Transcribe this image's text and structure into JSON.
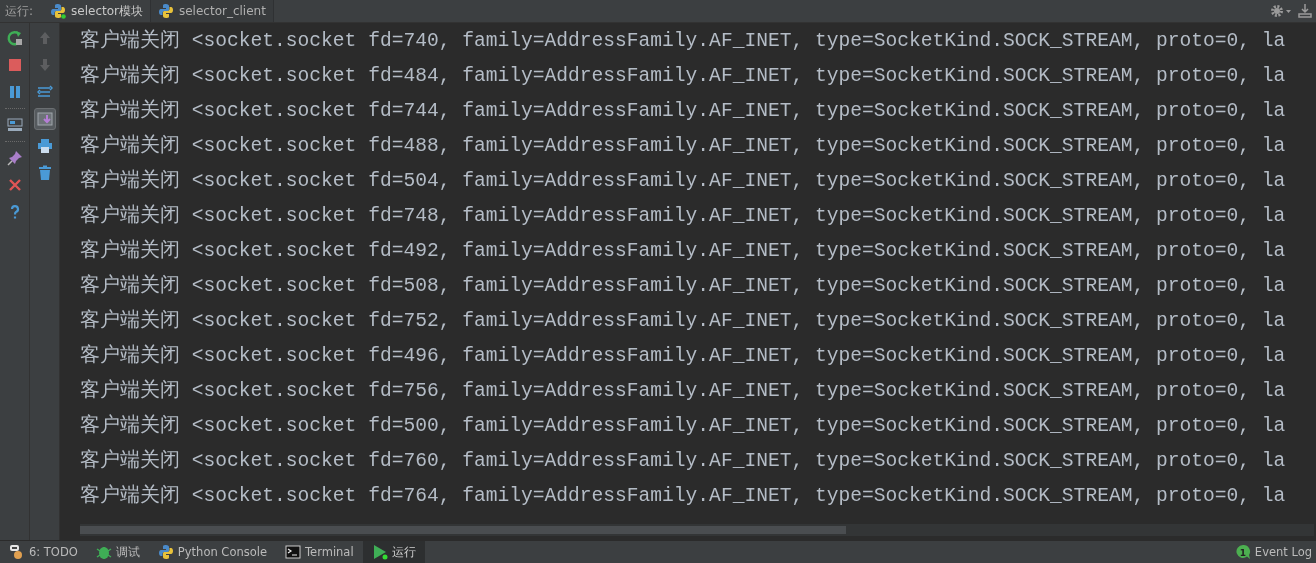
{
  "run_bar": {
    "label": "运行:",
    "tabs": [
      {
        "label": "selector模块",
        "selected": true,
        "running": true
      },
      {
        "label": "selector_client",
        "selected": false,
        "running": false
      }
    ]
  },
  "side_toolbar": [
    {
      "kind": "rerun",
      "disabled": false
    },
    {
      "kind": "stop",
      "disabled": false
    },
    {
      "kind": "pause",
      "disabled": false
    },
    {
      "kind": "layout",
      "disabled": false
    },
    {
      "kind": "pin",
      "disabled": false
    },
    {
      "kind": "close",
      "disabled": false
    },
    {
      "kind": "help",
      "disabled": false
    }
  ],
  "console_toolbar": [
    {
      "kind": "up",
      "disabled": true,
      "toggled": false
    },
    {
      "kind": "down",
      "disabled": true,
      "toggled": false
    },
    {
      "kind": "wrap",
      "disabled": false,
      "toggled": false
    },
    {
      "kind": "scroll_end",
      "disabled": false,
      "toggled": true
    },
    {
      "kind": "print",
      "disabled": false,
      "toggled": false
    },
    {
      "kind": "trash",
      "disabled": false,
      "toggled": false
    }
  ],
  "console_lines": [
    "客户端关闭 <socket.socket fd=740, family=AddressFamily.AF_INET, type=SocketKind.SOCK_STREAM, proto=0, la",
    "客户端关闭 <socket.socket fd=484, family=AddressFamily.AF_INET, type=SocketKind.SOCK_STREAM, proto=0, la",
    "客户端关闭 <socket.socket fd=744, family=AddressFamily.AF_INET, type=SocketKind.SOCK_STREAM, proto=0, la",
    "客户端关闭 <socket.socket fd=488, family=AddressFamily.AF_INET, type=SocketKind.SOCK_STREAM, proto=0, la",
    "客户端关闭 <socket.socket fd=504, family=AddressFamily.AF_INET, type=SocketKind.SOCK_STREAM, proto=0, la",
    "客户端关闭 <socket.socket fd=748, family=AddressFamily.AF_INET, type=SocketKind.SOCK_STREAM, proto=0, la",
    "客户端关闭 <socket.socket fd=492, family=AddressFamily.AF_INET, type=SocketKind.SOCK_STREAM, proto=0, la",
    "客户端关闭 <socket.socket fd=508, family=AddressFamily.AF_INET, type=SocketKind.SOCK_STREAM, proto=0, la",
    "客户端关闭 <socket.socket fd=752, family=AddressFamily.AF_INET, type=SocketKind.SOCK_STREAM, proto=0, la",
    "客户端关闭 <socket.socket fd=496, family=AddressFamily.AF_INET, type=SocketKind.SOCK_STREAM, proto=0, la",
    "客户端关闭 <socket.socket fd=756, family=AddressFamily.AF_INET, type=SocketKind.SOCK_STREAM, proto=0, la",
    "客户端关闭 <socket.socket fd=500, family=AddressFamily.AF_INET, type=SocketKind.SOCK_STREAM, proto=0, la",
    "客户端关闭 <socket.socket fd=760, family=AddressFamily.AF_INET, type=SocketKind.SOCK_STREAM, proto=0, la",
    "客户端关闭 <socket.socket fd=764, family=AddressFamily.AF_INET, type=SocketKind.SOCK_STREAM, proto=0, la"
  ],
  "bottom_tabs": [
    {
      "kind": "todo",
      "label": "6: TODO",
      "selected": false
    },
    {
      "kind": "debug",
      "label": "调试",
      "selected": false
    },
    {
      "kind": "python",
      "label": "Python Console",
      "selected": false
    },
    {
      "kind": "terminal",
      "label": "Terminal",
      "selected": false
    },
    {
      "kind": "run",
      "label": "运行",
      "selected": true
    }
  ],
  "event_log": {
    "label": "Event Log",
    "count": "1"
  }
}
